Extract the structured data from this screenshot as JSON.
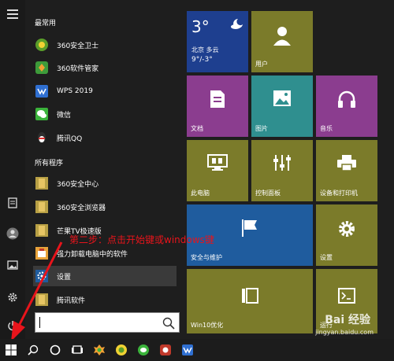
{
  "rail": {},
  "applist": {
    "section_recent": "最常用",
    "section_all": "所有程序",
    "recent": [
      {
        "label": "360安全卫士",
        "icon": "360-safe-icon",
        "color": "#5a9e2a"
      },
      {
        "label": "360软件管家",
        "icon": "360-software-icon",
        "color": "#3d9b3a"
      },
      {
        "label": "WPS 2019",
        "icon": "wps-icon",
        "color": "#2f6fd1"
      },
      {
        "label": "微信",
        "icon": "wechat-icon",
        "color": "#3bb33b"
      },
      {
        "label": "腾讯QQ",
        "icon": "qq-icon",
        "color": "#2f2f2f"
      }
    ],
    "all": [
      {
        "label": "360安全中心",
        "icon": "folder-icon",
        "color": "#e6c564"
      },
      {
        "label": "360安全浏览器",
        "icon": "folder-icon",
        "color": "#e6c564"
      },
      {
        "label": "芒果TV极速版",
        "icon": "folder-icon",
        "color": "#e6c564"
      },
      {
        "label": "强力卸载电脑中的软件",
        "icon": "uninstall-icon",
        "color": "#e8a33a"
      },
      {
        "label": "设置",
        "icon": "gear-icon",
        "color": "#1f5c9e"
      },
      {
        "label": "腾讯软件",
        "icon": "folder-icon",
        "color": "#e6c564"
      }
    ]
  },
  "search": {
    "placeholder": ""
  },
  "tiles": {
    "weather": {
      "temp": "3°",
      "city": "北京 多云",
      "range": "9°/-3°"
    },
    "user": "用户",
    "documents": "文档",
    "pictures": "图片",
    "music": "音乐",
    "this_pc": "此电脑",
    "control_panel": "控制面板",
    "devices_printers": "设备和打印机",
    "security_maintenance": "安全与维护",
    "settings": "设置",
    "win10_opt": "Win10优化",
    "run": "运行"
  },
  "annotation": "第二步：点击开始键或windows键",
  "watermark": {
    "logo": "Bai 经验",
    "url": "jingyan.baidu.com"
  },
  "colors": {
    "olive": "#7b7b2a",
    "purple": "#8b3d8f",
    "teal": "#2f8f8f",
    "navy": "#1f5c9e",
    "annotation_red": "#e8141b"
  }
}
